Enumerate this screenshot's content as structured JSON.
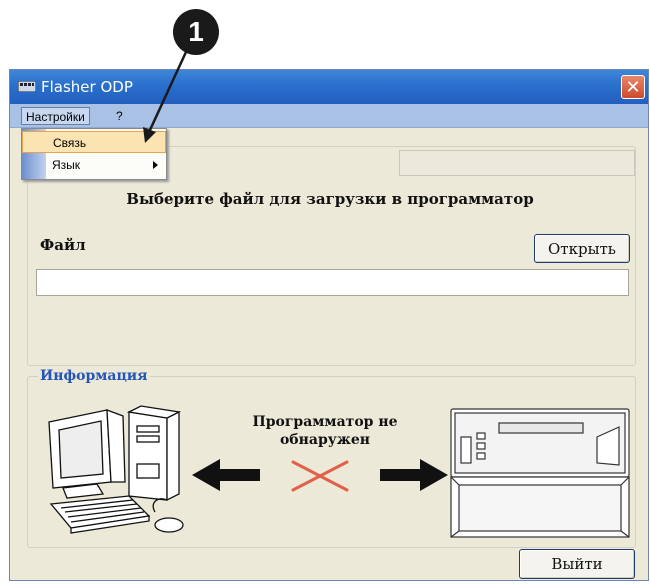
{
  "callout": {
    "number": "1"
  },
  "window": {
    "title": "Flasher ODP",
    "close_glyph": "✕"
  },
  "menu": {
    "settings": "Настройки",
    "help": "?"
  },
  "dropdown": {
    "connection": "Связь",
    "language": "Язык"
  },
  "file_group": {
    "prompt": "Выберите файл для загрузки в программатор",
    "file_label": "Файл",
    "open_button": "Открыть",
    "file_path_value": ""
  },
  "info_group": {
    "title": "Информация",
    "status_line1": "Программатор не",
    "status_line2": "обнаружен"
  },
  "footer": {
    "exit_button": "Выйти"
  },
  "icons": [
    "window-app-icon",
    "close-icon",
    "submenu-arrow-icon",
    "computer-illustration",
    "programmer-device-illustration",
    "left-arrow-icon",
    "right-arrow-icon",
    "disconnected-cross-icon"
  ],
  "colors": {
    "titlebar": "#2a6fcd",
    "menubar": "#a8c1e4",
    "window_bg": "#ece9d8",
    "info_title": "#2356b8",
    "cross": "#e0604a"
  }
}
